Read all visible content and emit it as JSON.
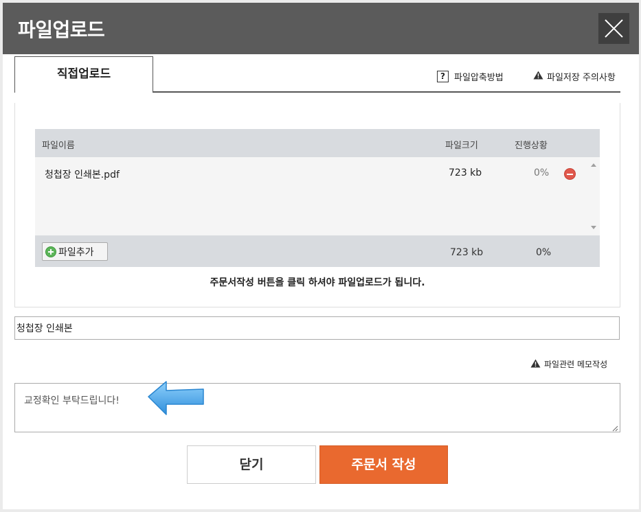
{
  "dialog": {
    "title": "파일업로드"
  },
  "tabs": [
    {
      "label": "직접업로드",
      "active": true
    }
  ],
  "links": {
    "compress_help": "파일압축방법",
    "storage_notice": "파일저장 주의사항",
    "memo_notice": "파일관련 메모작성"
  },
  "table": {
    "headers": [
      "파일이름",
      "파일크기",
      "진행상황"
    ],
    "rows": [
      {
        "name": "청첩장 인쇄본.pdf",
        "size": "723 kb",
        "progress": "0%"
      }
    ],
    "footer": {
      "add_label": "파일추가",
      "total_size": "723 kb",
      "total_progress": "0%"
    }
  },
  "notice": "주문서작성 버튼을 클릭 하셔야 파일업로드가 됩니다.",
  "filename_value": "청첩장 인쇄본",
  "memo_value": "교정확인 부탁드립니다!",
  "buttons": {
    "close": "닫기",
    "order": "주문서 작성"
  },
  "colors": {
    "titlebar": "#5b5b5b",
    "order_button": "#e9692f",
    "table_header": "#d8dbdf",
    "pointer_arrow": "#4aa8ea"
  }
}
